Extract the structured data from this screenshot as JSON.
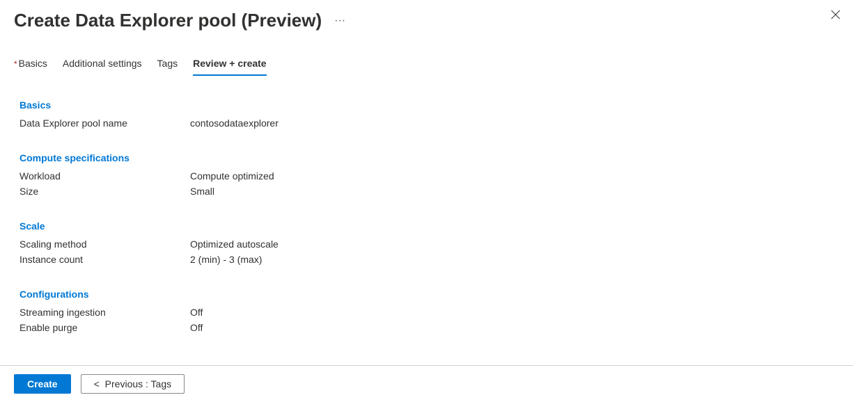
{
  "header": {
    "title": "Create Data Explorer pool (Preview)"
  },
  "tabs": {
    "basics_required_marker": "*",
    "basics": "Basics",
    "additional_settings": "Additional settings",
    "tags": "Tags",
    "review_create": "Review + create"
  },
  "sections": {
    "basics": {
      "title": "Basics",
      "pool_name_label": "Data Explorer pool name",
      "pool_name_value": "contosodataexplorer"
    },
    "compute": {
      "title": "Compute specifications",
      "workload_label": "Workload",
      "workload_value": "Compute optimized",
      "size_label": "Size",
      "size_value": "Small"
    },
    "scale": {
      "title": "Scale",
      "method_label": "Scaling method",
      "method_value": "Optimized autoscale",
      "instance_label": "Instance count",
      "instance_value": "2 (min) - 3 (max)"
    },
    "configurations": {
      "title": "Configurations",
      "streaming_label": "Streaming ingestion",
      "streaming_value": "Off",
      "purge_label": "Enable purge",
      "purge_value": "Off"
    }
  },
  "footer": {
    "create": "Create",
    "previous": "Previous : Tags"
  }
}
